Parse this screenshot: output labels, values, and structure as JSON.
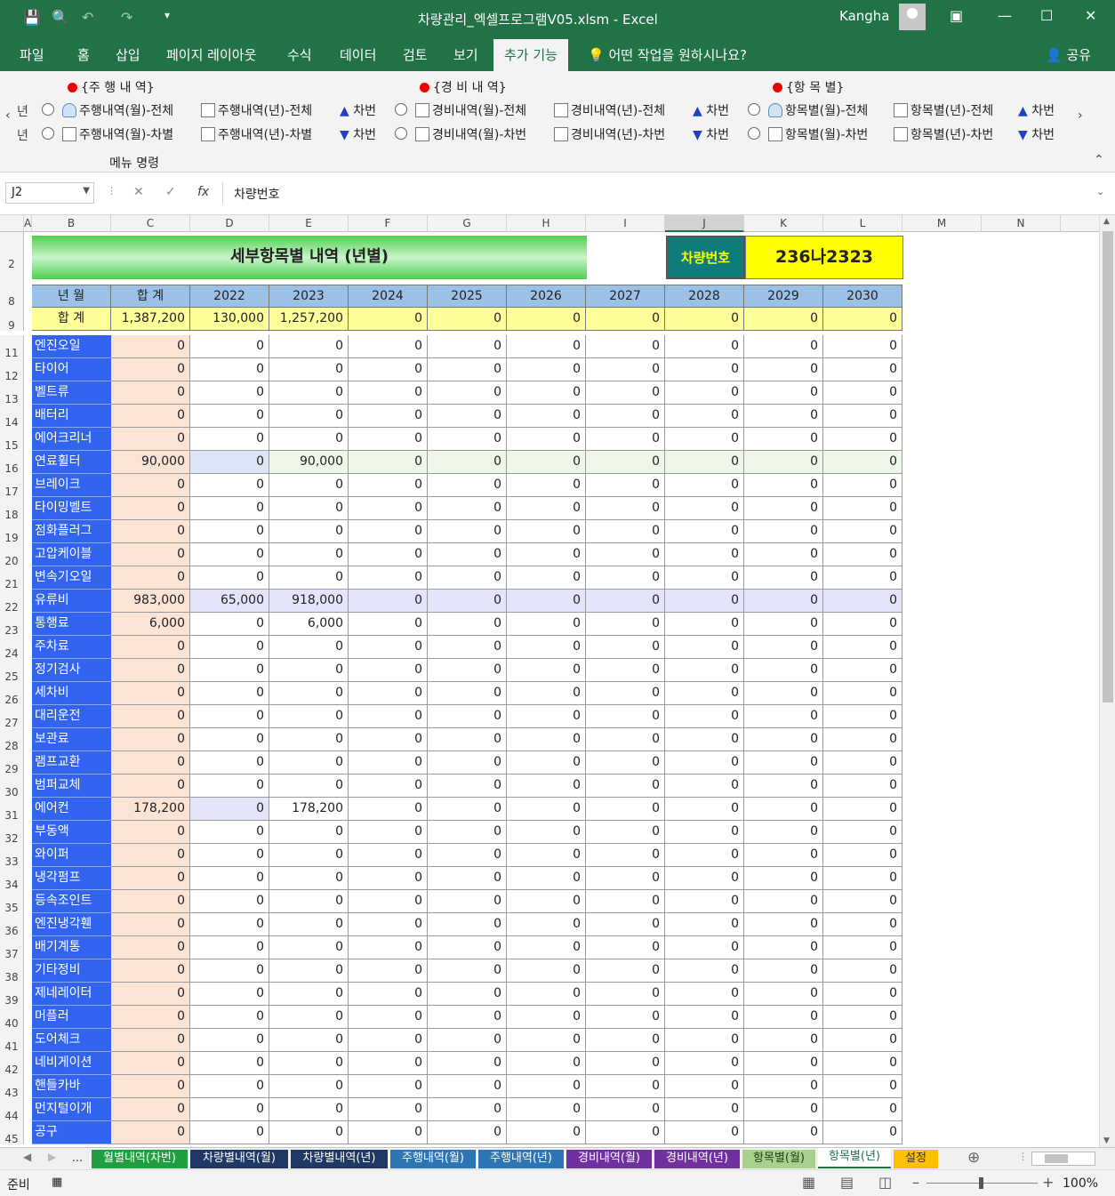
{
  "window": {
    "title": "차량관리_엑셀프로그램V05.xlsm  -  Excel",
    "user": "Kangha"
  },
  "ribbon_tabs": [
    "파일",
    "홈",
    "삽입",
    "페이지 레이아웃",
    "수식",
    "데이터",
    "검토",
    "보기",
    "추가 기능"
  ],
  "tell_me": "어떤 작업을 원하시나요?",
  "share": "공유",
  "ribbon": {
    "groups": [
      "{주 행 내 역}",
      "{경 비 내 역}",
      "{항 목 별}"
    ],
    "edge_left": "년",
    "row1": [
      "주행내역(월)-전체",
      "주행내역(년)-전체",
      "차번",
      "경비내역(월)-전체",
      "경비내역(년)-전체",
      "차번",
      "항목별(월)-전체",
      "항목별(년)-전체",
      "차번"
    ],
    "row2": [
      "주행내역(월)-차별",
      "주행내역(년)-차별",
      "차번",
      "경비내역(월)-차번",
      "경비내역(년)-차번",
      "차번",
      "항목별(월)-차번",
      "항목별(년)-차번",
      "차번"
    ],
    "group_label": "메뉴 명령"
  },
  "formula_bar": {
    "name_box": "J2",
    "content": "차량번호"
  },
  "columns": [
    "A",
    "B",
    "C",
    "D",
    "E",
    "F",
    "G",
    "H",
    "I",
    "J",
    "K",
    "L",
    "M",
    "N"
  ],
  "sheet": {
    "title": "세부항목별 내역 (년별)",
    "car_label": "차량번호",
    "car_number": "236나2323",
    "header": [
      "년  월",
      "합  계",
      "2022",
      "2023",
      "2024",
      "2025",
      "2026",
      "2027",
      "2028",
      "2029",
      "2030"
    ],
    "total_row": [
      "합  계",
      "1,387,200",
      "130,000",
      "1,257,200",
      "0",
      "0",
      "0",
      "0",
      "0",
      "0",
      "0"
    ],
    "rows": [
      {
        "r": "11",
        "label": "엔진오일",
        "v": [
          "0",
          "0",
          "0",
          "0",
          "0",
          "0",
          "0",
          "0",
          "0",
          "0"
        ]
      },
      {
        "r": "12",
        "label": "타이어",
        "v": [
          "0",
          "0",
          "0",
          "0",
          "0",
          "0",
          "0",
          "0",
          "0",
          "0"
        ]
      },
      {
        "r": "13",
        "label": "벨트류",
        "v": [
          "0",
          "0",
          "0",
          "0",
          "0",
          "0",
          "0",
          "0",
          "0",
          "0"
        ]
      },
      {
        "r": "14",
        "label": "배터리",
        "v": [
          "0",
          "0",
          "0",
          "0",
          "0",
          "0",
          "0",
          "0",
          "0",
          "0"
        ]
      },
      {
        "r": "15",
        "label": "에어크리너",
        "v": [
          "0",
          "0",
          "0",
          "0",
          "0",
          "0",
          "0",
          "0",
          "0",
          "0"
        ]
      },
      {
        "r": "16",
        "label": "연료휠터",
        "v": [
          "90,000",
          "0",
          "90,000",
          "0",
          "0",
          "0",
          "0",
          "0",
          "0",
          "0"
        ]
      },
      {
        "r": "17",
        "label": "브레이크",
        "v": [
          "0",
          "0",
          "0",
          "0",
          "0",
          "0",
          "0",
          "0",
          "0",
          "0"
        ]
      },
      {
        "r": "18",
        "label": "타이밍벨트",
        "v": [
          "0",
          "0",
          "0",
          "0",
          "0",
          "0",
          "0",
          "0",
          "0",
          "0"
        ]
      },
      {
        "r": "19",
        "label": "점화플러그",
        "v": [
          "0",
          "0",
          "0",
          "0",
          "0",
          "0",
          "0",
          "0",
          "0",
          "0"
        ]
      },
      {
        "r": "20",
        "label": "고압케이블",
        "v": [
          "0",
          "0",
          "0",
          "0",
          "0",
          "0",
          "0",
          "0",
          "0",
          "0"
        ]
      },
      {
        "r": "21",
        "label": "변속기오일",
        "v": [
          "0",
          "0",
          "0",
          "0",
          "0",
          "0",
          "0",
          "0",
          "0",
          "0"
        ]
      },
      {
        "r": "22",
        "label": "유류비",
        "v": [
          "983,000",
          "65,000",
          "918,000",
          "0",
          "0",
          "0",
          "0",
          "0",
          "0",
          "0"
        ]
      },
      {
        "r": "23",
        "label": "통행료",
        "v": [
          "6,000",
          "0",
          "6,000",
          "0",
          "0",
          "0",
          "0",
          "0",
          "0",
          "0"
        ]
      },
      {
        "r": "24",
        "label": "주차료",
        "v": [
          "0",
          "0",
          "0",
          "0",
          "0",
          "0",
          "0",
          "0",
          "0",
          "0"
        ]
      },
      {
        "r": "25",
        "label": "정기검사",
        "v": [
          "0",
          "0",
          "0",
          "0",
          "0",
          "0",
          "0",
          "0",
          "0",
          "0"
        ]
      },
      {
        "r": "26",
        "label": "세차비",
        "v": [
          "0",
          "0",
          "0",
          "0",
          "0",
          "0",
          "0",
          "0",
          "0",
          "0"
        ]
      },
      {
        "r": "27",
        "label": "대리운전",
        "v": [
          "0",
          "0",
          "0",
          "0",
          "0",
          "0",
          "0",
          "0",
          "0",
          "0"
        ]
      },
      {
        "r": "28",
        "label": "보관료",
        "v": [
          "0",
          "0",
          "0",
          "0",
          "0",
          "0",
          "0",
          "0",
          "0",
          "0"
        ]
      },
      {
        "r": "29",
        "label": "램프교환",
        "v": [
          "0",
          "0",
          "0",
          "0",
          "0",
          "0",
          "0",
          "0",
          "0",
          "0"
        ]
      },
      {
        "r": "30",
        "label": "범퍼교체",
        "v": [
          "0",
          "0",
          "0",
          "0",
          "0",
          "0",
          "0",
          "0",
          "0",
          "0"
        ]
      },
      {
        "r": "31",
        "label": "에어컨",
        "v": [
          "178,200",
          "0",
          "178,200",
          "0",
          "0",
          "0",
          "0",
          "0",
          "0",
          "0"
        ]
      },
      {
        "r": "32",
        "label": "부동액",
        "v": [
          "0",
          "0",
          "0",
          "0",
          "0",
          "0",
          "0",
          "0",
          "0",
          "0"
        ]
      },
      {
        "r": "33",
        "label": "와이퍼",
        "v": [
          "0",
          "0",
          "0",
          "0",
          "0",
          "0",
          "0",
          "0",
          "0",
          "0"
        ]
      },
      {
        "r": "34",
        "label": "냉각펌프",
        "v": [
          "0",
          "0",
          "0",
          "0",
          "0",
          "0",
          "0",
          "0",
          "0",
          "0"
        ]
      },
      {
        "r": "35",
        "label": "등속조인트",
        "v": [
          "0",
          "0",
          "0",
          "0",
          "0",
          "0",
          "0",
          "0",
          "0",
          "0"
        ]
      },
      {
        "r": "36",
        "label": "엔진냉각휀",
        "v": [
          "0",
          "0",
          "0",
          "0",
          "0",
          "0",
          "0",
          "0",
          "0",
          "0"
        ]
      },
      {
        "r": "37",
        "label": "배기계통",
        "v": [
          "0",
          "0",
          "0",
          "0",
          "0",
          "0",
          "0",
          "0",
          "0",
          "0"
        ]
      },
      {
        "r": "38",
        "label": "기타정비",
        "v": [
          "0",
          "0",
          "0",
          "0",
          "0",
          "0",
          "0",
          "0",
          "0",
          "0"
        ]
      },
      {
        "r": "39",
        "label": "제네레이터",
        "v": [
          "0",
          "0",
          "0",
          "0",
          "0",
          "0",
          "0",
          "0",
          "0",
          "0"
        ]
      },
      {
        "r": "40",
        "label": "머플러",
        "v": [
          "0",
          "0",
          "0",
          "0",
          "0",
          "0",
          "0",
          "0",
          "0",
          "0"
        ]
      },
      {
        "r": "41",
        "label": "도어체크",
        "v": [
          "0",
          "0",
          "0",
          "0",
          "0",
          "0",
          "0",
          "0",
          "0",
          "0"
        ]
      },
      {
        "r": "42",
        "label": "네비게이션",
        "v": [
          "0",
          "0",
          "0",
          "0",
          "0",
          "0",
          "0",
          "0",
          "0",
          "0"
        ]
      },
      {
        "r": "43",
        "label": "핸들카바",
        "v": [
          "0",
          "0",
          "0",
          "0",
          "0",
          "0",
          "0",
          "0",
          "0",
          "0"
        ]
      },
      {
        "r": "44",
        "label": "먼지털이개",
        "v": [
          "0",
          "0",
          "0",
          "0",
          "0",
          "0",
          "0",
          "0",
          "0",
          "0"
        ]
      },
      {
        "r": "45",
        "label": "공구",
        "v": [
          "0",
          "0",
          "0",
          "0",
          "0",
          "0",
          "0",
          "0",
          "0",
          "0"
        ]
      }
    ]
  },
  "sheet_tabs": [
    {
      "label": "...",
      "color": "#f0f0f0",
      "text": "#333"
    },
    {
      "label": "월별내역(차번)",
      "color": "#1f9f3f",
      "text": "#ffffff"
    },
    {
      "label": "차량별내역(월)",
      "color": "#1f3864",
      "text": "#ffffff"
    },
    {
      "label": "차량별내역(년)",
      "color": "#1f3864",
      "text": "#ffffff"
    },
    {
      "label": "주행내역(월)",
      "color": "#2e75b6",
      "text": "#ffffff"
    },
    {
      "label": "주행내역(년)",
      "color": "#2e75b6",
      "text": "#ffffff"
    },
    {
      "label": "경비내역(월)",
      "color": "#7030a0",
      "text": "#ffffff"
    },
    {
      "label": "경비내역(년)",
      "color": "#7030a0",
      "text": "#ffffff"
    },
    {
      "label": "항목별(월)",
      "color": "#a9d18e",
      "text": "#1f3d10"
    },
    {
      "label": "항목별(년)",
      "color": "#ffffff",
      "text": "#217346"
    },
    {
      "label": "설정",
      "color": "#ffc000",
      "text": "#333333"
    }
  ],
  "status": {
    "ready": "준비",
    "zoom": "100%"
  }
}
